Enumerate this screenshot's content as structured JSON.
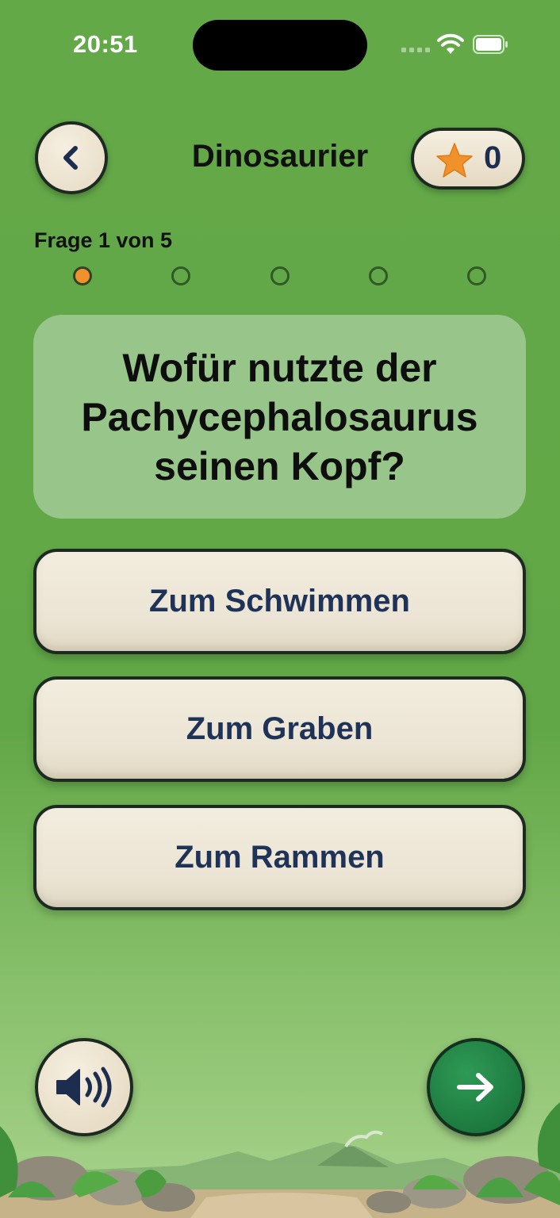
{
  "status_bar": {
    "time": "20:51"
  },
  "header": {
    "title": "Dinosaurier",
    "score": "0"
  },
  "progress": {
    "label": "Frage 1 von 5",
    "current": 1,
    "total": 5
  },
  "question": {
    "text": "Wofür nutzte der Pachycephalosaurus seinen Kopf?"
  },
  "answers": [
    {
      "label": "Zum Schwimmen"
    },
    {
      "label": "Zum Graben"
    },
    {
      "label": "Zum Rammen"
    }
  ],
  "icons": {
    "back": "chevron-left-icon",
    "score": "star-icon",
    "sound": "speaker-icon",
    "next": "arrow-right-icon"
  },
  "colors": {
    "background": "#64a948",
    "accent_orange": "#f0922b",
    "answer_text": "#1f3358",
    "next_button": "#1e7d42",
    "question_card": "#98c589"
  }
}
